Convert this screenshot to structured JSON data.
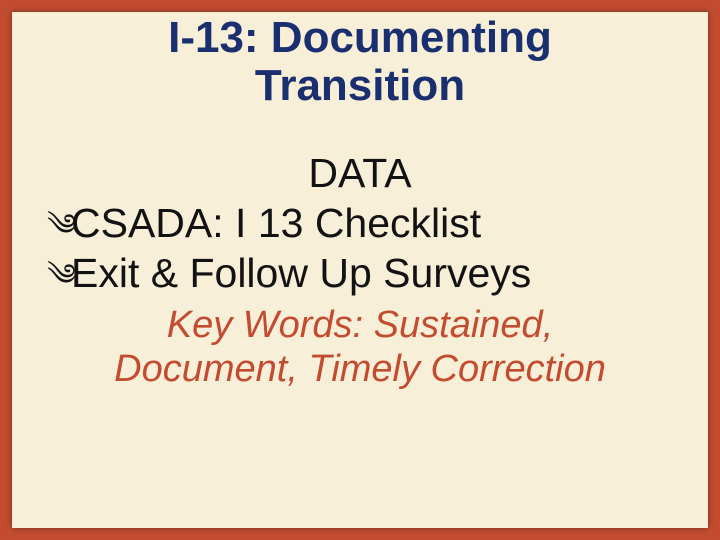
{
  "title_line1": "I-13: Documenting",
  "title_line2": "Transition",
  "section_heading": "DATA",
  "bullets": {
    "item1": "CSADA: I 13 Checklist",
    "item2": "Exit & Follow Up Surveys"
  },
  "keywords_line1": "Key Words: Sustained,",
  "keywords_line2": "Document, Timely Correction",
  "bullet_glyph": "༄"
}
